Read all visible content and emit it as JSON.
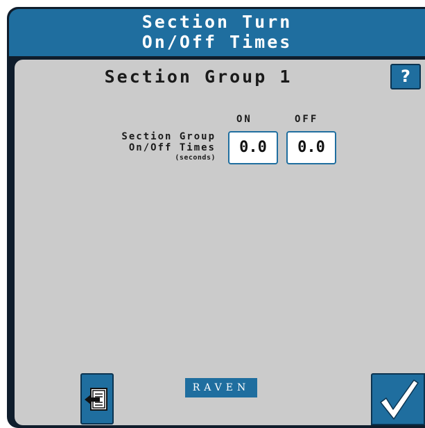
{
  "header": {
    "title": "Section Turn\nOn/Off Times"
  },
  "panel": {
    "group_title": "Section Group 1",
    "help_label": "?",
    "columns": {
      "on": "ON",
      "off": "OFF"
    },
    "setting": {
      "label_line1": "Section Group",
      "label_line2": "On/Off Times",
      "unit": "(seconds)",
      "on_value": "0.0",
      "off_value": "0.0"
    }
  },
  "footer": {
    "brand_text": "RAVEN",
    "back_icon": "back-page-icon",
    "accept_icon": "checkmark-icon"
  },
  "colors": {
    "header_blue": "#1f6e9f",
    "panel_gray": "#cbcbcb",
    "frame_dark": "#0f1d2c"
  }
}
